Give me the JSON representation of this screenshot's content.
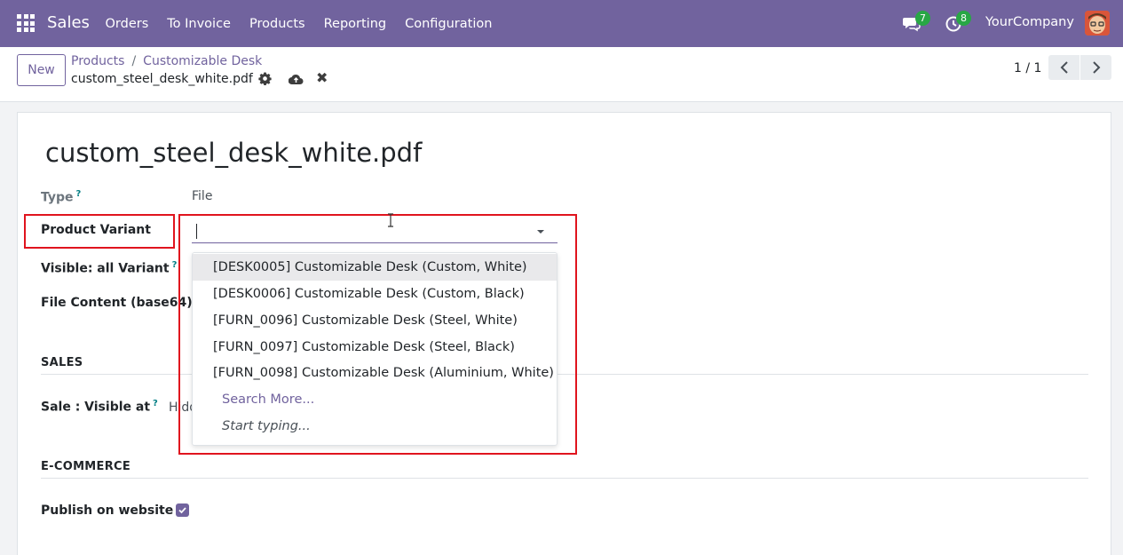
{
  "navbar": {
    "app_name": "Sales",
    "menu": [
      "Orders",
      "To Invoice",
      "Products",
      "Reporting",
      "Configuration"
    ],
    "chat_count": "7",
    "activity_count": "8",
    "company": "YourCompany",
    "bg_color": "#71639e"
  },
  "control_panel": {
    "new_label": "New",
    "breadcrumb": [
      "Products",
      "Customizable Desk"
    ],
    "breadcrumb_sep": "/",
    "record_name": "custom_steel_desk_white.pdf",
    "pager": "1 / 1"
  },
  "form": {
    "title": "custom_steel_desk_white.pdf",
    "type_label": "Type",
    "type_value": "File",
    "product_variant_label": "Product Variant",
    "product_variant_value": "",
    "visible_label": "Visible: all Variant",
    "file_content_label": "File Content (base64)",
    "section_sales": "SALES",
    "sale_visible_label": "Sale : Visible at",
    "sale_visible_value": "Hidd",
    "section_ecommerce": "E-COMMERCE",
    "publish_label": "Publish on website",
    "publish_checked": true,
    "help_mark": "?"
  },
  "dropdown": {
    "options": [
      "[DESK0005] Customizable Desk (Custom, White)",
      "[DESK0006] Customizable Desk (Custom, Black)",
      "[FURN_0096] Customizable Desk (Steel, White)",
      "[FURN_0097] Customizable Desk (Steel, Black)",
      "[FURN_0098] Customizable Desk (Aluminium, White)"
    ],
    "search_more": "Search More...",
    "start_typing": "Start typing..."
  }
}
